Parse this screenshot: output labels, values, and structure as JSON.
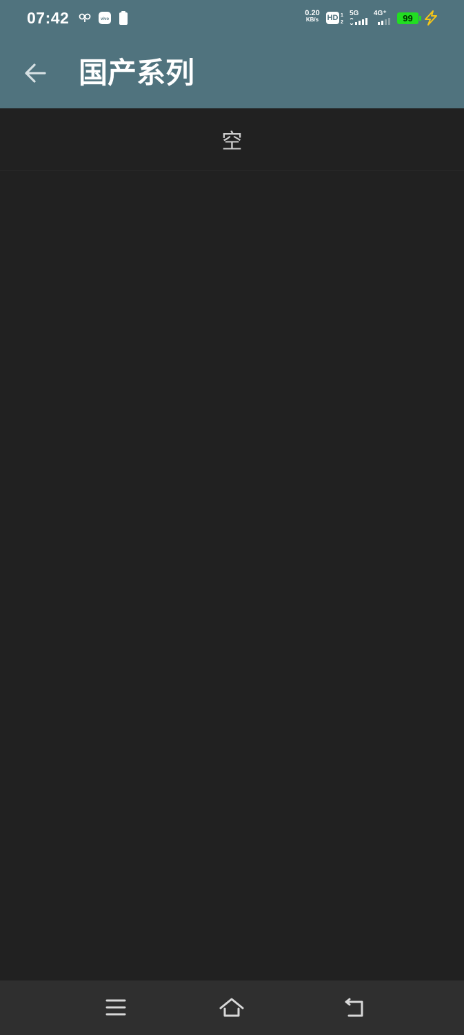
{
  "status_bar": {
    "time": "07:42",
    "net_speed_value": "0.20",
    "net_speed_unit": "KB/s",
    "hd_label": "HD",
    "sim1_label": "5G",
    "sim2_label": "4G⁺",
    "battery_level": "99"
  },
  "app_bar": {
    "title": "国产系列"
  },
  "content": {
    "empty_text": "空"
  },
  "colors": {
    "app_bar": "#50737e",
    "background": "#212121",
    "nav_bar": "#2f2f2f",
    "battery": "#22dd22"
  }
}
